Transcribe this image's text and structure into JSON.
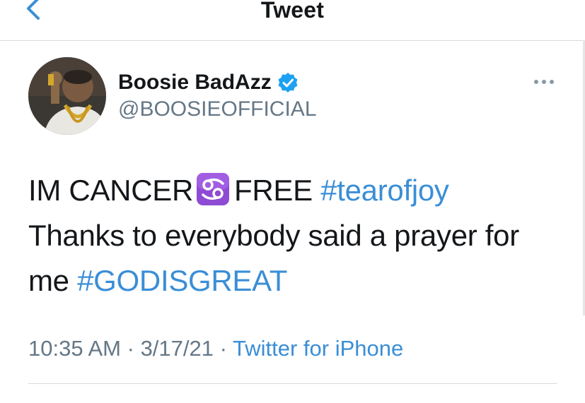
{
  "header": {
    "title": "Tweet",
    "back_icon": "chevron-left-icon"
  },
  "author": {
    "name": "Boosie BadAzz",
    "handle": "@BOOSIEOFFICIAL",
    "verified": true,
    "verified_color": "#1DA1F2"
  },
  "tweet": {
    "line1_prefix": "IM CANCER",
    "emoji": "cancer-zodiac-emoji",
    "line1_suffix": "FREE",
    "hashtag1": "#tearofjoy",
    "line2": "Thanks to everybody said a prayer for",
    "line3_prefix": "me",
    "hashtag2": "#GODISGREAT"
  },
  "meta": {
    "time": "10:35 AM",
    "sep1": "·",
    "date": "3/17/21",
    "sep2": "·",
    "source": "Twitter for iPhone"
  },
  "colors": {
    "link": "#3A8ED6",
    "secondary_text": "#657786",
    "divider": "#D7D9DC"
  }
}
